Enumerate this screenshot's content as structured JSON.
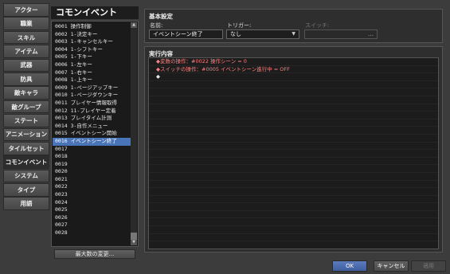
{
  "tabs": [
    "アクター",
    "職業",
    "スキル",
    "アイテム",
    "武器",
    "防具",
    "敵キャラ",
    "敵グループ",
    "ステート",
    "アニメーション",
    "タイルセット",
    "コモンイベント",
    "システム",
    "タイプ",
    "用語"
  ],
  "active_tab": 11,
  "list": {
    "title": "コモンイベント",
    "items": [
      "0001 操作制御",
      "0002 1-決定キー",
      "0003 1-キャンセルキー",
      "0004 1-シフトキー",
      "0005 1-下キー",
      "0006 1-左キー",
      "0007 1-右キー",
      "0008 1-上キー",
      "0009 1-ページアップキー",
      "0010 1-ページダウンキー",
      "0011 プレイヤー情報取得",
      "0012 11-プレイヤー定着",
      "0013 プレイタイム計測",
      "0014 3-自作メニュー",
      "0015 イベントシーン開始",
      "0016 イベントシーン終了",
      "0017",
      "0018",
      "0019",
      "0020",
      "0021",
      "0022",
      "0023",
      "0024",
      "0025",
      "0026",
      "0027",
      "0028"
    ],
    "selected_index": 15,
    "max_button": "最大数の変更..."
  },
  "settings": {
    "title": "基本設定",
    "name_label": "名前:",
    "name_value": "イベントシーン終了",
    "trigger_label": "トリガー:",
    "trigger_value": "なし",
    "switch_label": "スイッチ:",
    "switch_value": ""
  },
  "contents": {
    "title": "実行内容",
    "lines": [
      "◆変数の操作：#0022 操作シーン = 0",
      "◆スイッチの操作：#0005 イベントシーン進行中 = OFF",
      "◆"
    ]
  },
  "buttons": {
    "ok": "OK",
    "cancel": "キャンセル",
    "apply": "適用"
  }
}
